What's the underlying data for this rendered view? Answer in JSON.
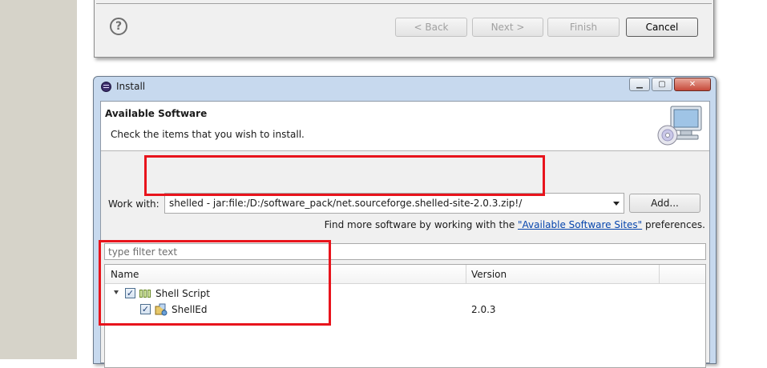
{
  "previous_dialog": {
    "help_icon": "help-icon",
    "back_label": "< Back",
    "next_label": "Next >",
    "finish_label": "Finish",
    "cancel_label": "Cancel"
  },
  "install_dialog": {
    "title": "Install",
    "minimize_glyph": "▁",
    "maximize_glyph": "▢",
    "close_glyph": "✕",
    "banner_title": "Available Software",
    "banner_desc": "Check the items that you wish to install.",
    "work_with_label": "Work with:",
    "work_with_value": "shelled - jar:file:/D:/software_pack/net.sourceforge.shelled-site-2.0.3.zip!/",
    "add_label": "Add...",
    "find_more_prefix": "Find more software by working with the ",
    "find_more_link": "\"Available Software Sites\"",
    "find_more_suffix": " preferences.",
    "filter_placeholder": "type filter text",
    "columns": {
      "name": "Name",
      "version": "Version"
    },
    "items": [
      {
        "name": "Shell Script",
        "version": "",
        "checked": true,
        "expanded": true
      },
      {
        "name": "ShellEd",
        "version": "2.0.3",
        "checked": true
      }
    ],
    "check_glyph": "✓",
    "highlight_color": "#e8141c"
  }
}
